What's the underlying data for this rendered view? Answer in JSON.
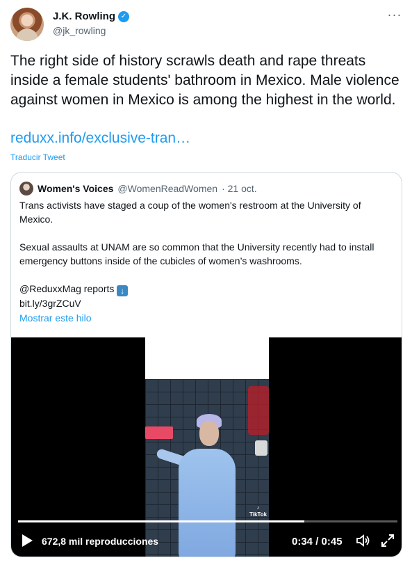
{
  "author": {
    "name": "J.K. Rowling",
    "handle": "@jk_rowling",
    "verified_icon": "verified-badge-icon"
  },
  "more_icon": "more-horizontal-icon",
  "tweet": {
    "text": "The right side of history scrawls death and rape threats inside a female students' bathroom in Mexico. Male violence against women in Mexico is among the highest in the world.",
    "link": "reduxx.info/exclusive-tran…",
    "translate": "Traducir Tweet"
  },
  "quote": {
    "name": "Women's Voices",
    "handle": "@WomenReadWomen",
    "date": "· 21 oct.",
    "paragraph1": "Trans activists have staged a coup of the women's restroom at the University of Mexico.",
    "paragraph2": "Sexual assaults at UNAM are so common that the University recently had to install emergency buttons inside of the cubicles of women’s washrooms.",
    "reports": "@ReduxxMag reports",
    "short_link": "bit.ly/3grZCuV",
    "show_thread": "Mostrar este hilo"
  },
  "video": {
    "views": "672,8 mil reproducciones",
    "time": "0:34 / 0:45",
    "progress": 0.755,
    "watermark": "TikTok",
    "icons": [
      "play-icon",
      "volume-icon",
      "expand-icon"
    ]
  },
  "colors": {
    "accent": "#1d9bf0",
    "text": "#0f1419",
    "secondary": "#536471",
    "border": "#cfd9de"
  }
}
